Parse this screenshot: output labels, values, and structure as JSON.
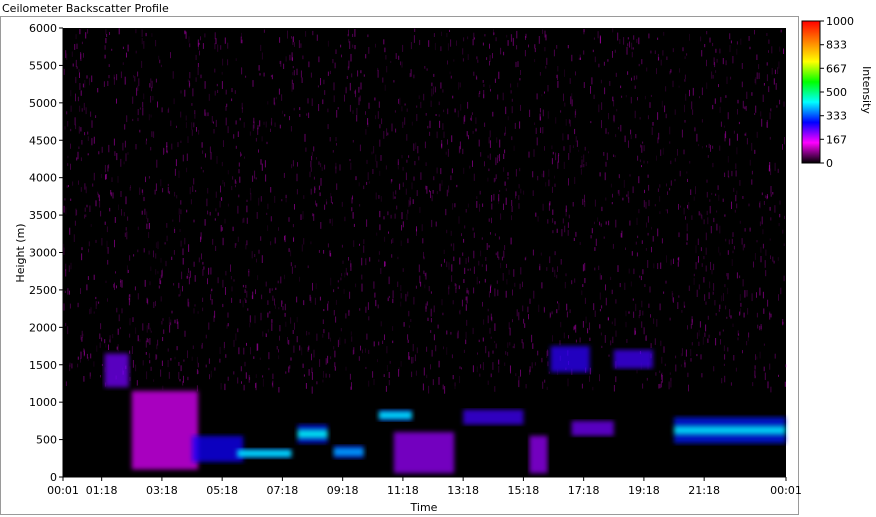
{
  "window": {
    "title": "Ceilometer Backscatter Profile"
  },
  "chart_data": {
    "type": "heatmap",
    "title": "Ceilometer Backscatter Profile",
    "xlabel": "Time",
    "ylabel": "Height (m)",
    "x_ticks": [
      "00:01",
      "01:18",
      "03:18",
      "05:18",
      "07:18",
      "09:18",
      "11:18",
      "13:18",
      "15:18",
      "17:18",
      "19:18",
      "21:18",
      "00:01"
    ],
    "x_tick_hours": [
      0.0167,
      1.3,
      3.3,
      5.3,
      7.3,
      9.3,
      11.3,
      13.3,
      15.3,
      17.3,
      19.3,
      21.3,
      24.0167
    ],
    "xlim_hours": [
      0.0167,
      24.0167
    ],
    "y_ticks": [
      0,
      500,
      1000,
      1500,
      2000,
      2500,
      3000,
      3500,
      4000,
      4500,
      5000,
      5500,
      6000
    ],
    "ylim": [
      0,
      6000
    ],
    "colorbar": {
      "label": "Intensity",
      "ticks": [
        0,
        167,
        333,
        500,
        667,
        833,
        1000
      ],
      "tick_labels": [
        "0",
        "167",
        "333",
        "500",
        "667",
        "833",
        "1000"
      ],
      "range": [
        0,
        1000
      ],
      "colors": [
        "#000000",
        "#ff00ff",
        "#0000ff",
        "#00ffff",
        "#00ff00",
        "#ffff00",
        "#ff8000",
        "#ff0000"
      ]
    },
    "background": "#000000",
    "noise_color": "#ff00ff",
    "layers": [
      {
        "hours": [
          1.4,
          2.2
        ],
        "height": [
          1200,
          1650
        ],
        "intensity": 220
      },
      {
        "hours": [
          2.3,
          4.5
        ],
        "height": [
          100,
          1150
        ],
        "intensity": 160
      },
      {
        "hours": [
          4.3,
          6.0
        ],
        "height": [
          200,
          550
        ],
        "intensity": 280
      },
      {
        "hours": [
          5.8,
          7.6
        ],
        "height": [
          250,
          380
        ],
        "intensity": 420
      },
      {
        "hours": [
          7.8,
          8.8
        ],
        "height": [
          450,
          700
        ],
        "intensity": 430
      },
      {
        "hours": [
          9.0,
          10.0
        ],
        "height": [
          250,
          420
        ],
        "intensity": 380
      },
      {
        "hours": [
          10.5,
          11.6
        ],
        "height": [
          750,
          900
        ],
        "intensity": 420
      },
      {
        "hours": [
          11.0,
          13.0
        ],
        "height": [
          50,
          600
        ],
        "intensity": 200
      },
      {
        "hours": [
          13.3,
          15.3
        ],
        "height": [
          700,
          900
        ],
        "intensity": 250
      },
      {
        "hours": [
          15.5,
          16.1
        ],
        "height": [
          50,
          550
        ],
        "intensity": 200
      },
      {
        "hours": [
          16.2,
          17.5
        ],
        "height": [
          1400,
          1750
        ],
        "intensity": 260
      },
      {
        "hours": [
          16.9,
          18.3
        ],
        "height": [
          550,
          750
        ],
        "intensity": 220
      },
      {
        "hours": [
          18.3,
          19.6
        ],
        "height": [
          1450,
          1700
        ],
        "intensity": 250
      },
      {
        "hours": [
          20.3,
          24.0
        ],
        "height": [
          450,
          800
        ],
        "intensity": 420
      }
    ]
  }
}
